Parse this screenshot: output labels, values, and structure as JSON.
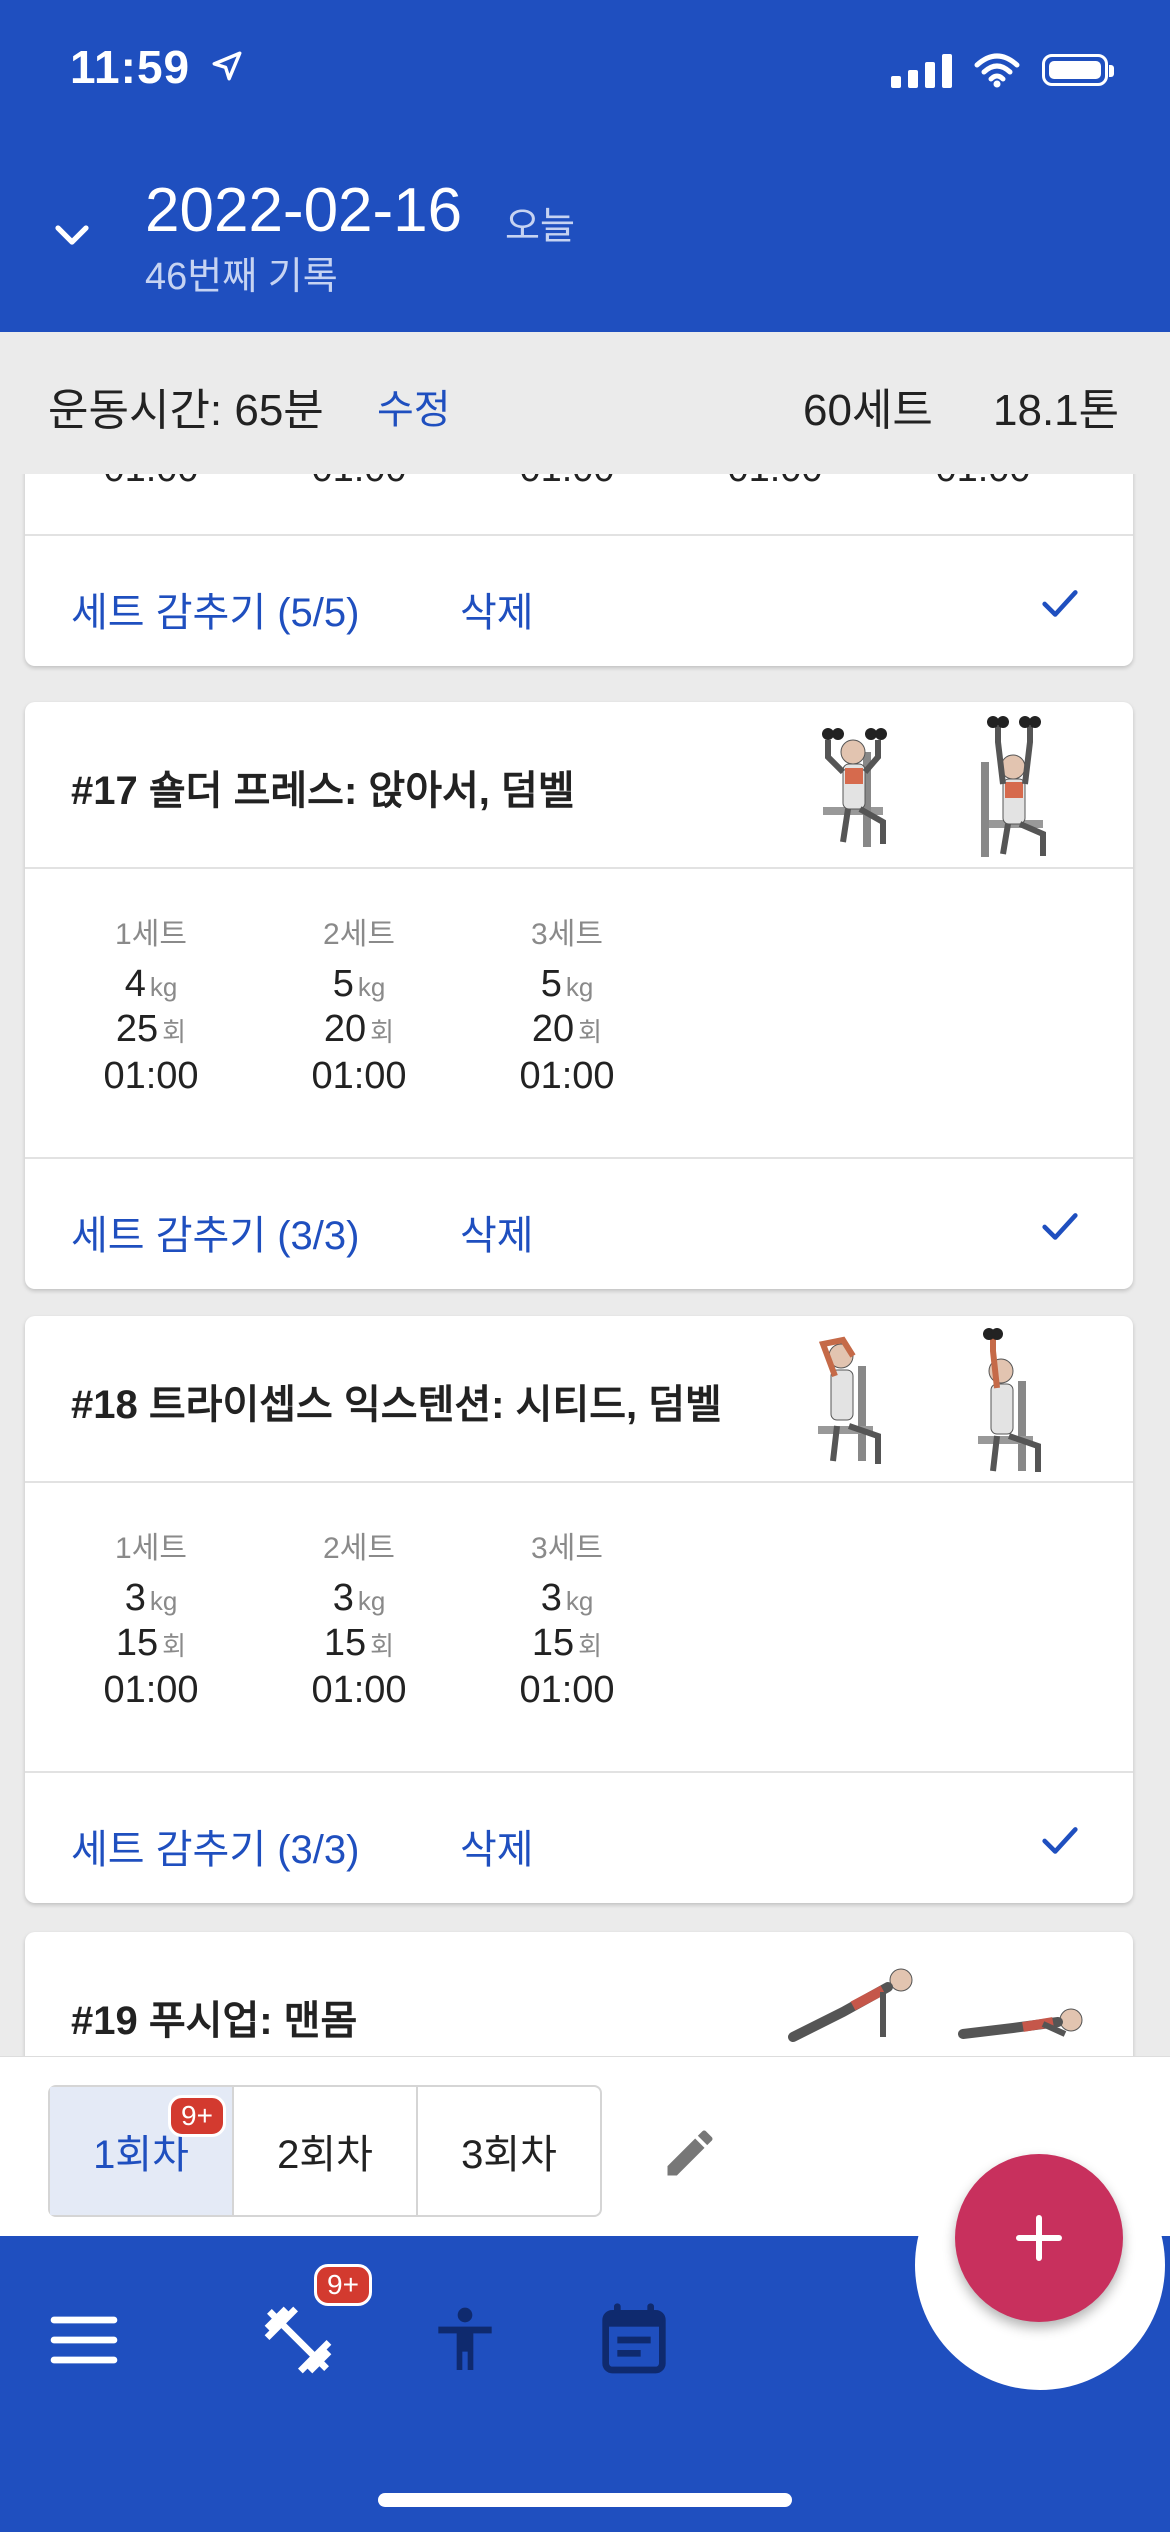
{
  "status_bar": {
    "time": "11:59"
  },
  "header": {
    "date": "2022-02-16",
    "today_label": "오늘",
    "record_label": "46번째 기록"
  },
  "summary": {
    "workout_time": "운동시간: 65분",
    "edit_label": "수정",
    "total_sets": "60세트",
    "total_weight": "18.1톤"
  },
  "cards": [
    {
      "partial": true,
      "times": [
        "01:00",
        "01:00",
        "01:00",
        "01:00",
        "01:00"
      ],
      "hide_label": "세트 감추기 (5/5)",
      "delete_label": "삭제"
    },
    {
      "title": "#17 숄더 프레스: 앉아서, 덤벨",
      "sets": [
        {
          "label": "1세트",
          "weight": "4",
          "reps": "25",
          "time": "01:00"
        },
        {
          "label": "2세트",
          "weight": "5",
          "reps": "20",
          "time": "01:00"
        },
        {
          "label": "3세트",
          "weight": "5",
          "reps": "20",
          "time": "01:00"
        }
      ],
      "hide_label": "세트 감추기 (3/3)",
      "delete_label": "삭제"
    },
    {
      "title": "#18 트라이셉스 익스텐션: 시티드, 덤벨",
      "sets": [
        {
          "label": "1세트",
          "weight": "3",
          "reps": "15",
          "time": "01:00"
        },
        {
          "label": "2세트",
          "weight": "3",
          "reps": "15",
          "time": "01:00"
        },
        {
          "label": "3세트",
          "weight": "3",
          "reps": "15",
          "time": "01:00"
        }
      ],
      "hide_label": "세트 감추기 (3/3)",
      "delete_label": "삭제"
    },
    {
      "title": "#19 푸시업: 맨몸"
    }
  ],
  "units": {
    "kg": "kg",
    "reps": "회"
  },
  "round_tabs": {
    "tabs": [
      "1회차",
      "2회차",
      "3회차"
    ],
    "badge": "9+"
  },
  "bottom_nav": {
    "badge": "9+"
  },
  "colors": {
    "primary": "#1f4fbf",
    "fab": "#c8305d",
    "badge": "#d33a2f"
  }
}
